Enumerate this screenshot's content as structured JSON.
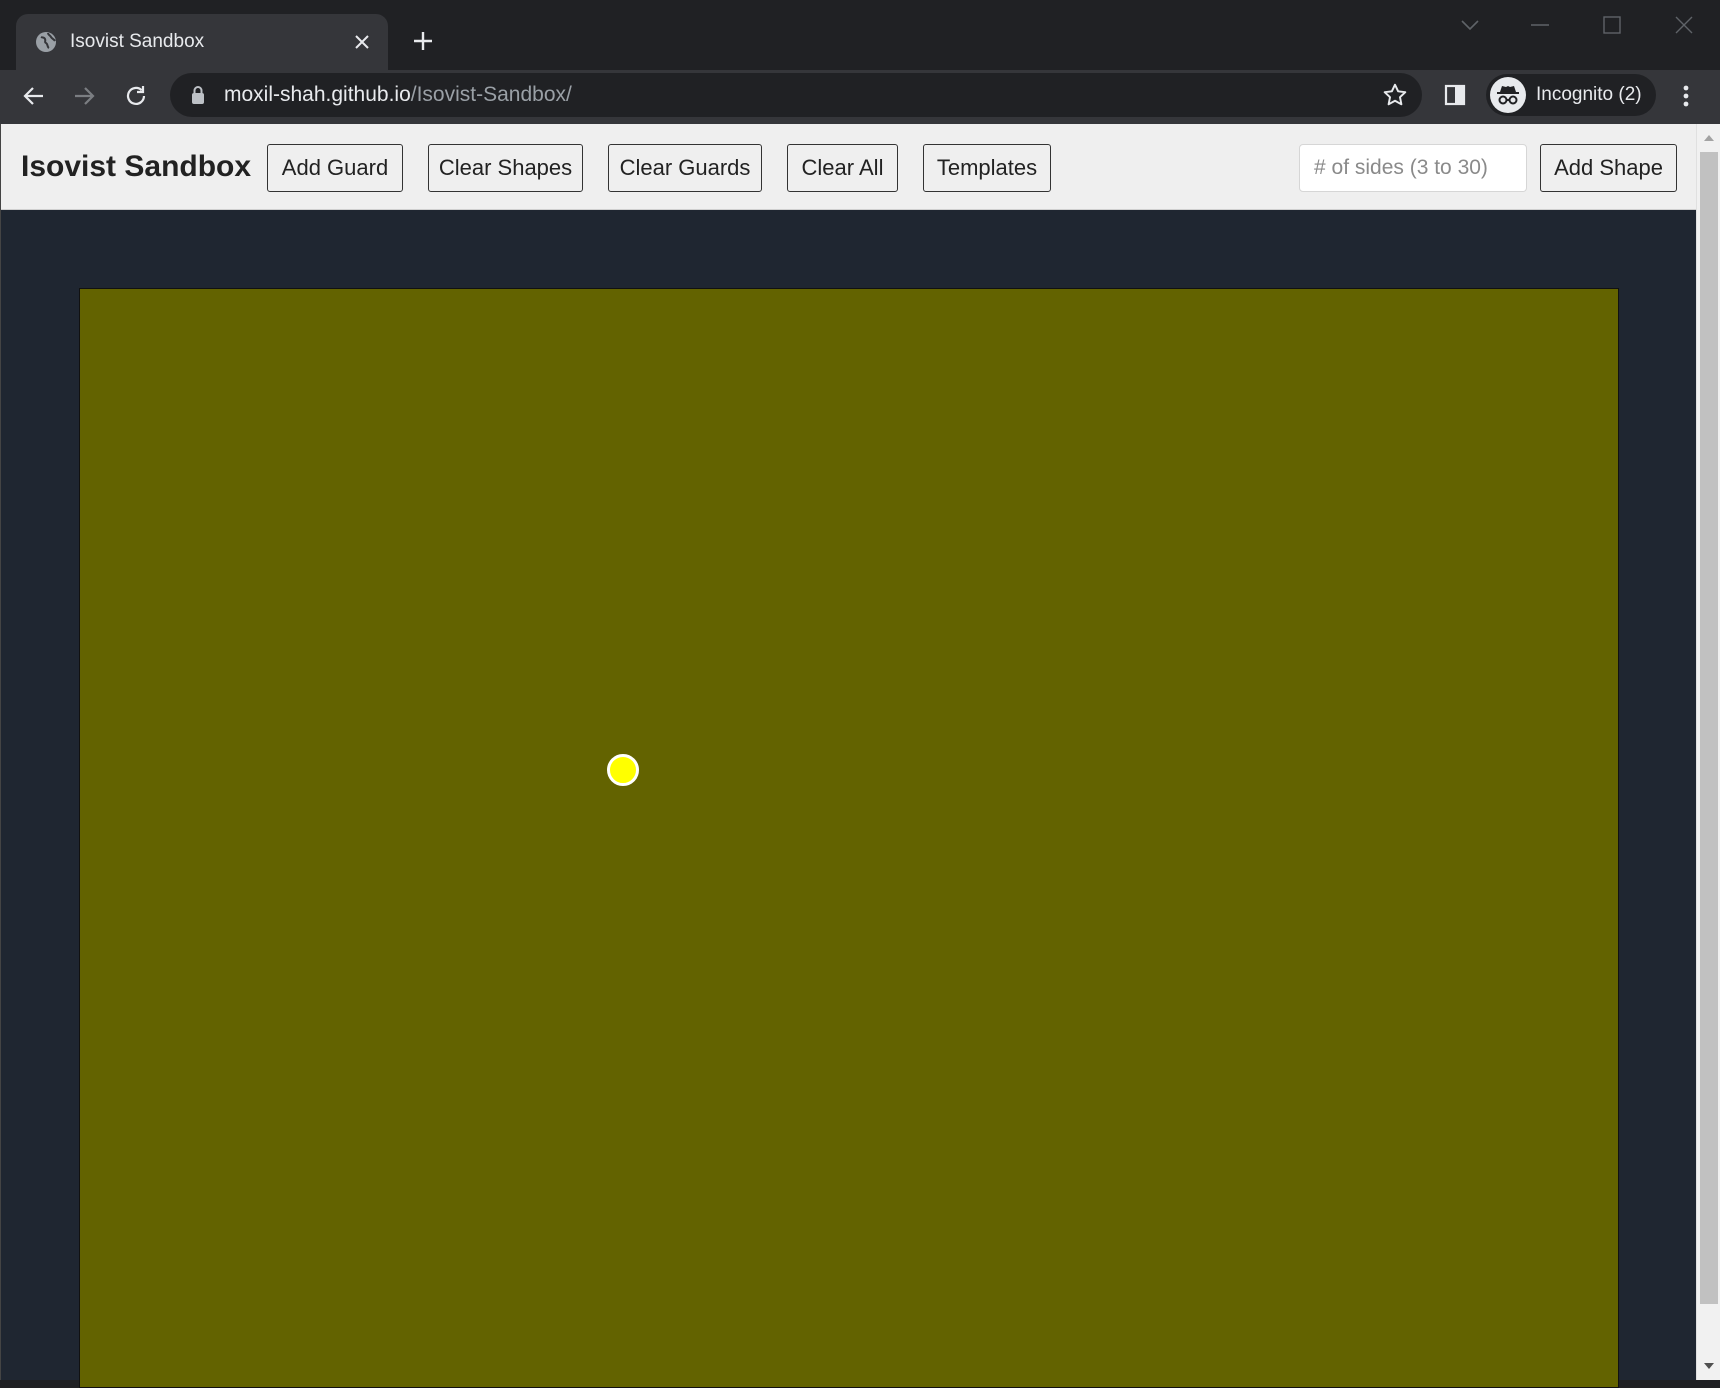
{
  "browser": {
    "tab": {
      "title": "Isovist Sandbox",
      "favicon": "globe-icon"
    },
    "address": {
      "host": "moxil-shah.github.io",
      "path": "/Isovist-Sandbox/"
    },
    "profile": {
      "label": "Incognito (2)"
    }
  },
  "app": {
    "title": "Isovist Sandbox",
    "buttons": {
      "add_guard": "Add Guard",
      "clear_shapes": "Clear Shapes",
      "clear_guards": "Clear Guards",
      "clear_all": "Clear All",
      "templates": "Templates",
      "add_shape": "Add Shape"
    },
    "sides_input": {
      "placeholder": "# of sides (3 to 30)",
      "value": ""
    }
  },
  "colors": {
    "canvas": "#636300",
    "page_background": "#1f2631",
    "guard_fill": "#ffff00",
    "guard_stroke": "#ffffff"
  }
}
